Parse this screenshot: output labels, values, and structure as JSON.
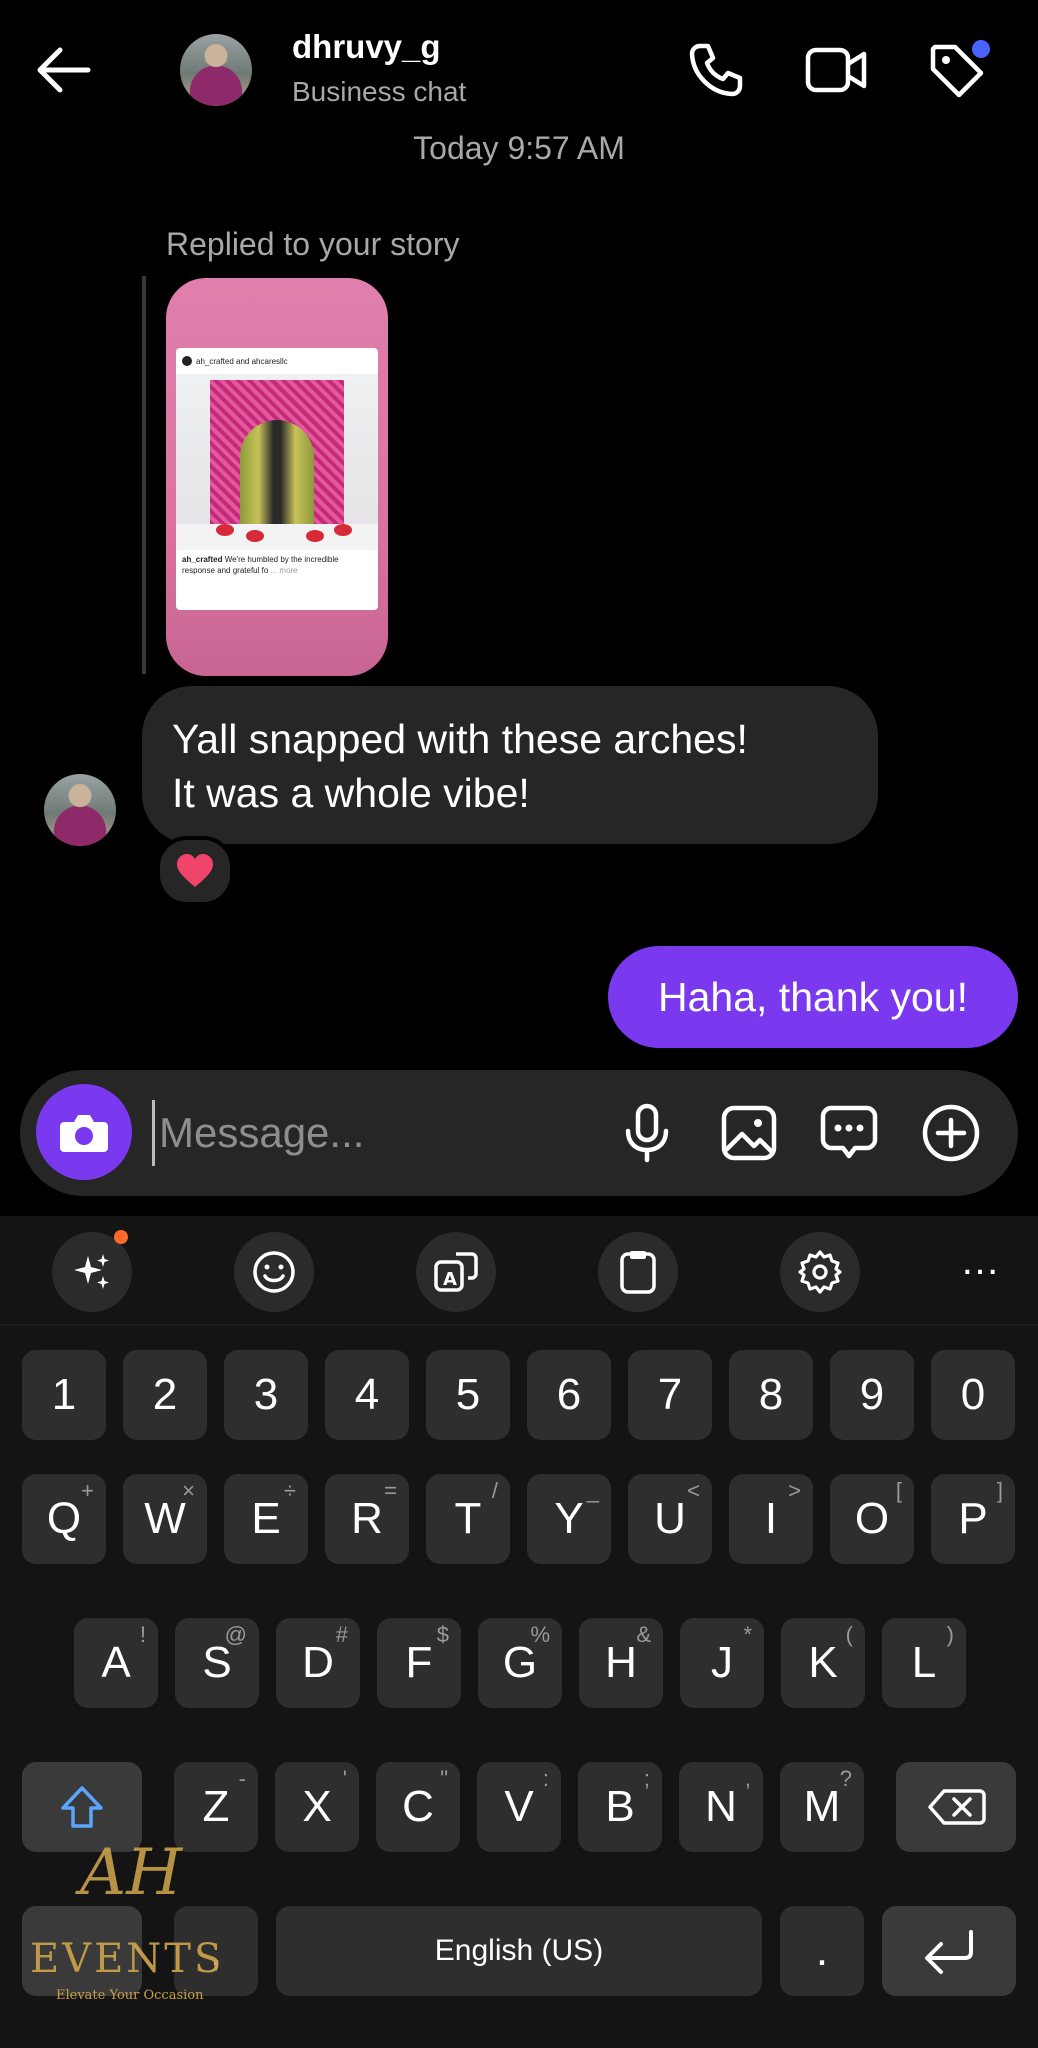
{
  "header": {
    "name": "dhruvy_g",
    "subtitle": "Business chat"
  },
  "thread": {
    "timestamp": "Today 9:57 AM",
    "replied_label": "Replied to your story",
    "story": {
      "account": "ah_crafted and ahcaresllc",
      "caption_user": "ah_crafted",
      "caption_text": "We're humbled by the incredible response and grateful fo",
      "more": "... more"
    },
    "incoming_line1": "Yall snapped with these arches!",
    "incoming_line2": "It was a whole vibe!",
    "reaction": "❤️",
    "outgoing": "Haha, thank you!"
  },
  "composer": {
    "placeholder": "Message..."
  },
  "keyboard": {
    "more": "…",
    "row_numbers": [
      "1",
      "2",
      "3",
      "4",
      "5",
      "6",
      "7",
      "8",
      "9",
      "0"
    ],
    "row1": [
      {
        "k": "Q",
        "s": "+"
      },
      {
        "k": "W",
        "s": "×"
      },
      {
        "k": "E",
        "s": "÷"
      },
      {
        "k": "R",
        "s": "="
      },
      {
        "k": "T",
        "s": "/"
      },
      {
        "k": "Y",
        "s": "_"
      },
      {
        "k": "U",
        "s": "<"
      },
      {
        "k": "I",
        "s": ">"
      },
      {
        "k": "O",
        "s": "["
      },
      {
        "k": "P",
        "s": "]"
      }
    ],
    "row2": [
      {
        "k": "A",
        "s": "!"
      },
      {
        "k": "S",
        "s": "@"
      },
      {
        "k": "D",
        "s": "#"
      },
      {
        "k": "F",
        "s": "$"
      },
      {
        "k": "G",
        "s": "%"
      },
      {
        "k": "H",
        "s": "&"
      },
      {
        "k": "J",
        "s": "*"
      },
      {
        "k": "K",
        "s": "("
      },
      {
        "k": "L",
        "s": ")"
      }
    ],
    "row3": [
      {
        "k": "Z",
        "s": "-"
      },
      {
        "k": "X",
        "s": "'"
      },
      {
        "k": "C",
        "s": "\""
      },
      {
        "k": "V",
        "s": ":"
      },
      {
        "k": "B",
        "s": ";"
      },
      {
        "k": "N",
        "s": ","
      },
      {
        "k": "M",
        "s": "?"
      }
    ],
    "comma": ",",
    "space": "English (US)",
    "period": "."
  },
  "watermark": {
    "mark": "AH",
    "brand": "EVENTS",
    "tagline": "Elevate Your Occasion"
  }
}
